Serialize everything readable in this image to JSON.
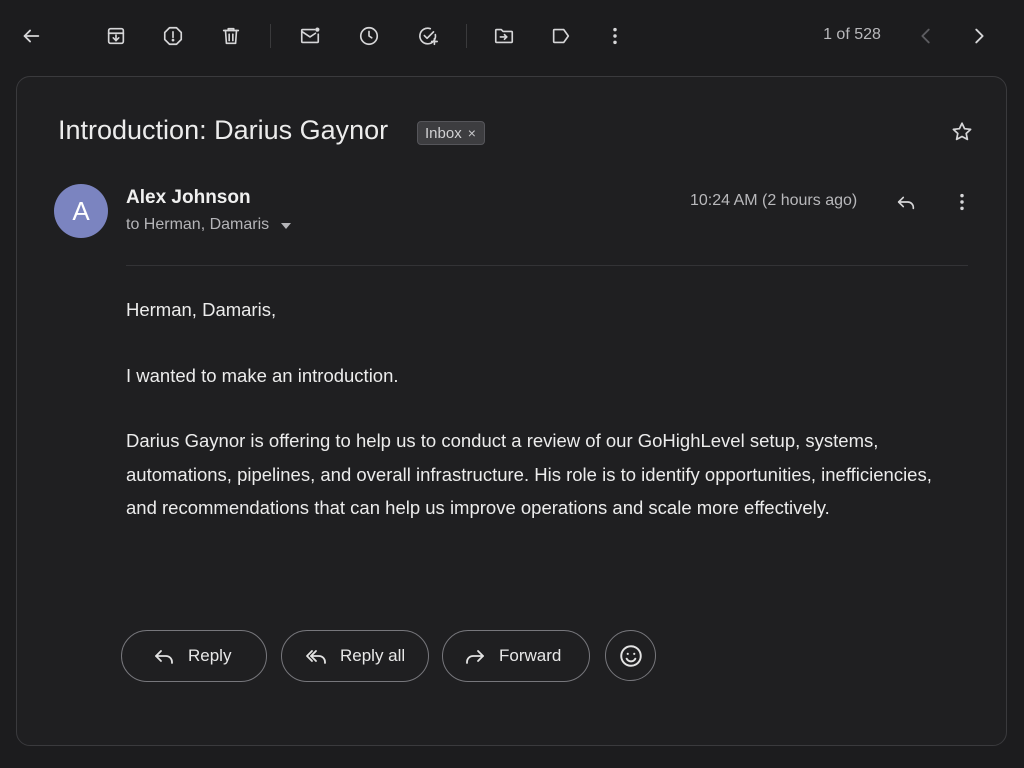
{
  "colors": {
    "background": "#1c1c1e",
    "card": "#1f1f21",
    "avatar": "#7b84c0",
    "text_primary": "#ececec",
    "text_secondary": "#b8b8bb"
  },
  "toolbar": {
    "icons": {
      "back": "back-arrow-icon",
      "archive": "archive-icon",
      "spam": "report-spam-icon",
      "delete": "trash-icon",
      "unread": "mark-unread-icon",
      "snooze": "snooze-clock-icon",
      "task": "add-to-tasks-icon",
      "move": "move-to-folder-icon",
      "label": "label-icon",
      "more": "more-vert-icon",
      "prev": "chevron-left-icon",
      "next": "chevron-right-icon"
    },
    "pager": "1 of 528"
  },
  "message": {
    "subject": "Introduction: Darius Gaynor",
    "label": "Inbox",
    "label_remove": "×",
    "sender": {
      "initial": "A",
      "name": "Alex Johnson",
      "recipients": "to Herman, Damaris"
    },
    "timestamp": "10:24 AM (2 hours ago)",
    "body": [
      "Herman, Damaris,",
      "I wanted to make an introduction.",
      "Darius Gaynor is offering to help us to conduct a review of our GoHighLevel setup, systems, automations, pipelines, and overall infrastructure. His role is to identify opportunities, inefficiencies, and recommendations that can help us improve operations and scale more effectively."
    ]
  },
  "actions": {
    "reply": "Reply",
    "reply_all": "Reply all",
    "forward": "Forward",
    "emoji": "add-reaction-icon"
  }
}
